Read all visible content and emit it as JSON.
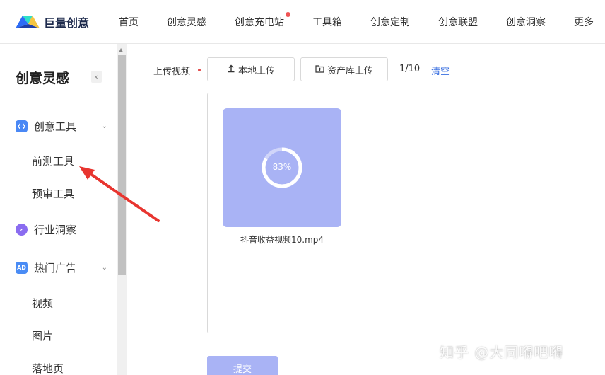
{
  "brand": {
    "name": "巨量创意"
  },
  "nav": {
    "items": [
      "首页",
      "创意灵感",
      "创意充电站",
      "工具箱",
      "创意定制",
      "创意联盟",
      "创意洞察",
      "更多"
    ],
    "badge_item_index": 2
  },
  "sidebar": {
    "title": "创意灵感",
    "collapse_glyph": "‹",
    "groups": [
      {
        "label": "创意工具",
        "icon": "code-brackets-icon",
        "expanded": true,
        "children": [
          "前测工具",
          "预审工具"
        ]
      },
      {
        "label": "行业洞察",
        "icon": "compass-icon"
      },
      {
        "label": "热门广告",
        "icon": "ad-icon",
        "icon_text": "AD",
        "expanded": true,
        "children": [
          "视频",
          "图片",
          "落地页"
        ]
      }
    ]
  },
  "upload": {
    "label": "上传视频",
    "local_button": "本地上传",
    "asset_button": "资产库上传",
    "count": "1/10",
    "clear": "清空",
    "file": {
      "name": "抖音收益视频10.mp4",
      "progress_text": "83%",
      "progress": 0.83
    }
  },
  "submit_label": "提交",
  "watermark": "知乎 @大同嘚吧嘚",
  "colors": {
    "brand_blue": "#2d6cf6",
    "link": "#3a6fe0",
    "required": "#e34d4d",
    "badge": "#f05454",
    "thumb_bg": "#a9b3f5",
    "submit_bg": "#a9b3f5",
    "annotation_arrow": "#e8352f",
    "icon_code": "#4a88f5",
    "icon_compass": "#8a6cf0",
    "icon_ad": "#4a8cf5"
  }
}
